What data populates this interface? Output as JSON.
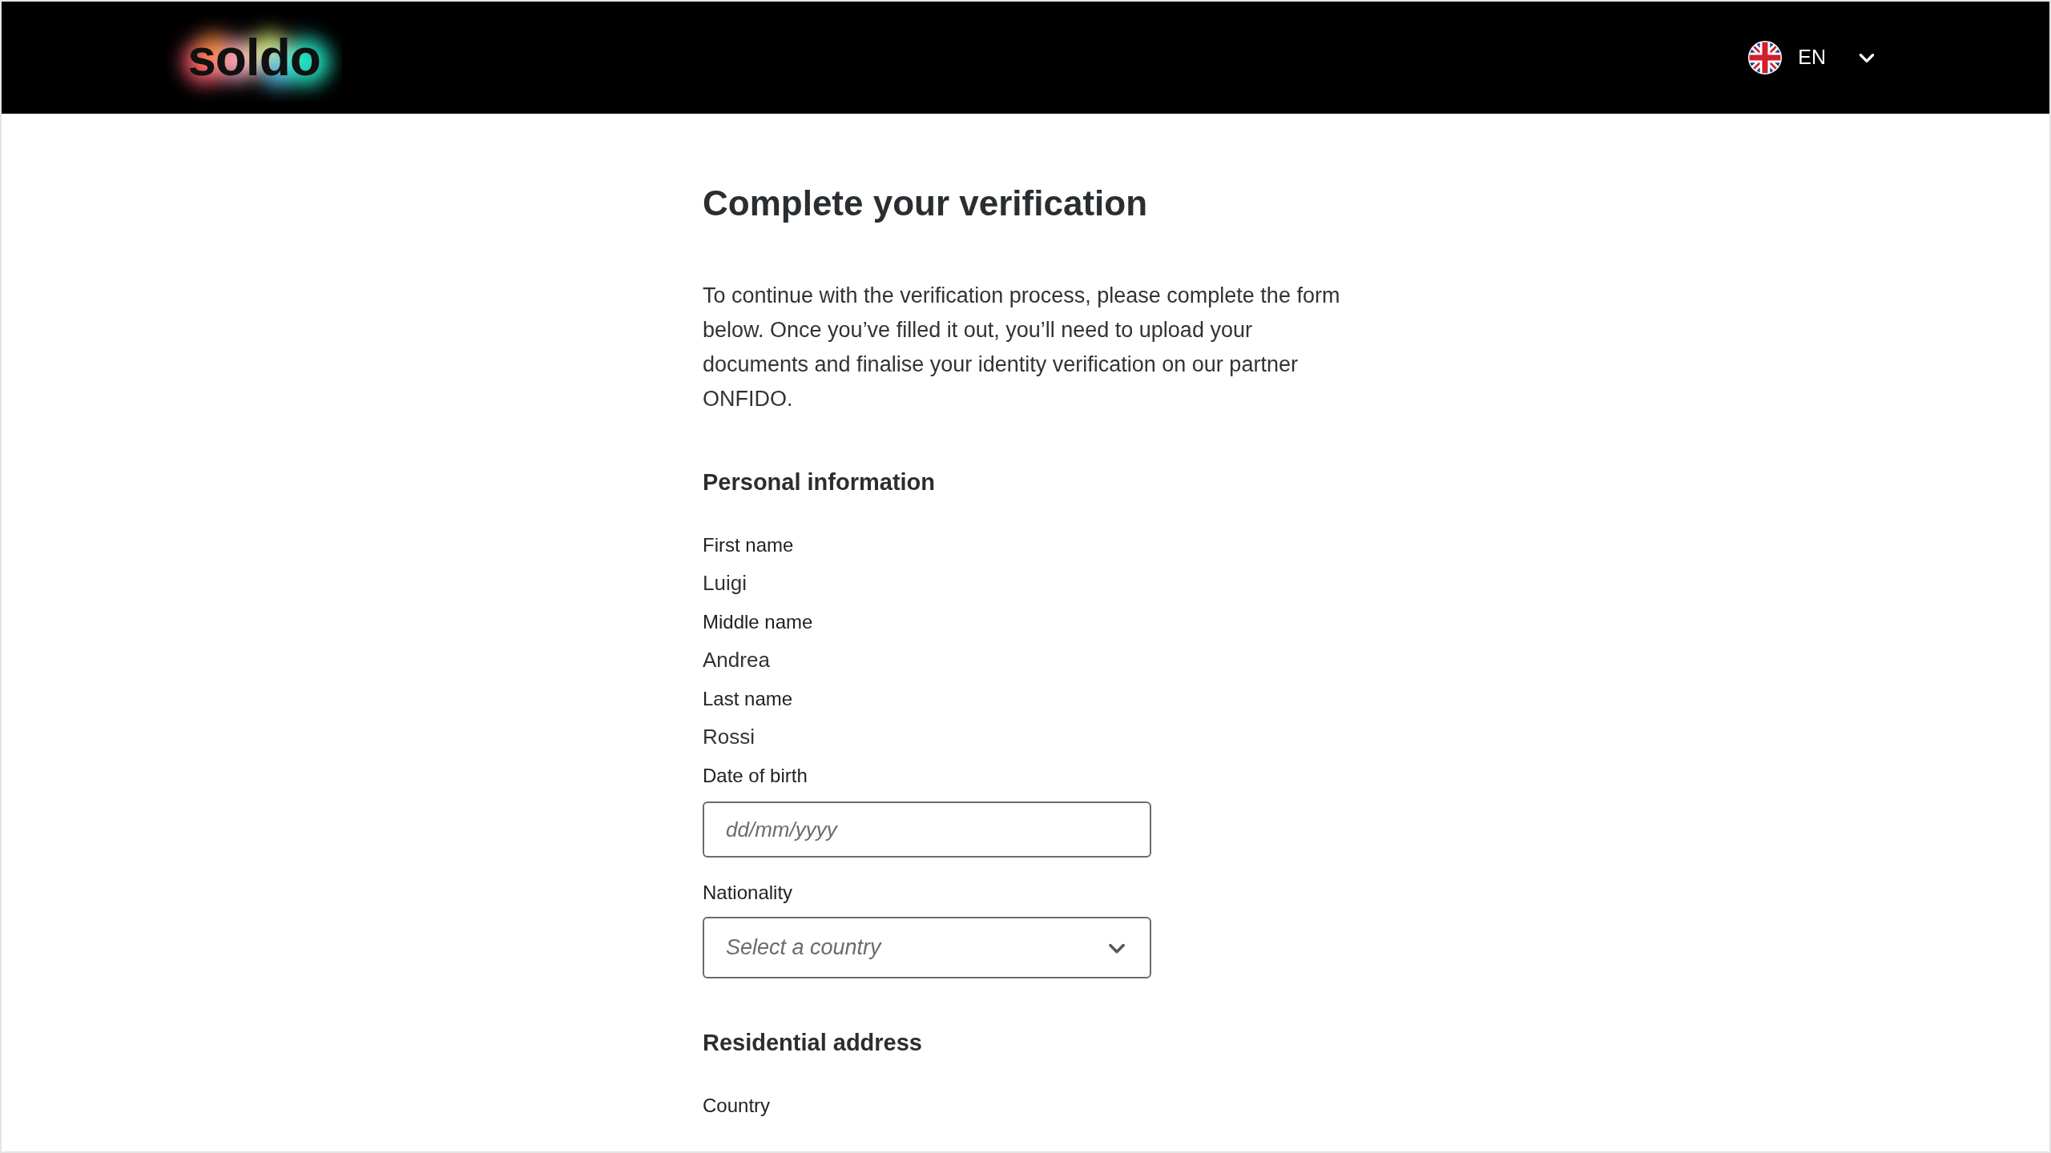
{
  "header": {
    "logo": "soldo",
    "language": "EN"
  },
  "title": "Complete your verification",
  "intro": "To continue with the verification process, please complete the form below. Once you’ve filled it out, you’ll need to upload your documents and finalise your identity verification on our partner ONFIDO.",
  "sections": [
    {
      "heading": "Personal information",
      "fields": [
        {
          "kind": "readonly",
          "label": "First name",
          "value": "Luigi"
        },
        {
          "kind": "readonly",
          "label": "Middle name",
          "value": "Andrea"
        },
        {
          "kind": "readonly",
          "label": "Last name",
          "value": "Rossi"
        },
        {
          "kind": "date",
          "label": "Date of birth",
          "placeholder": "dd/mm/yyyy"
        },
        {
          "kind": "select",
          "label": "Nationality",
          "placeholder": "Select a country"
        }
      ]
    },
    {
      "heading": "Residential address",
      "fields": [
        {
          "kind": "label",
          "label": "Country"
        }
      ]
    }
  ]
}
